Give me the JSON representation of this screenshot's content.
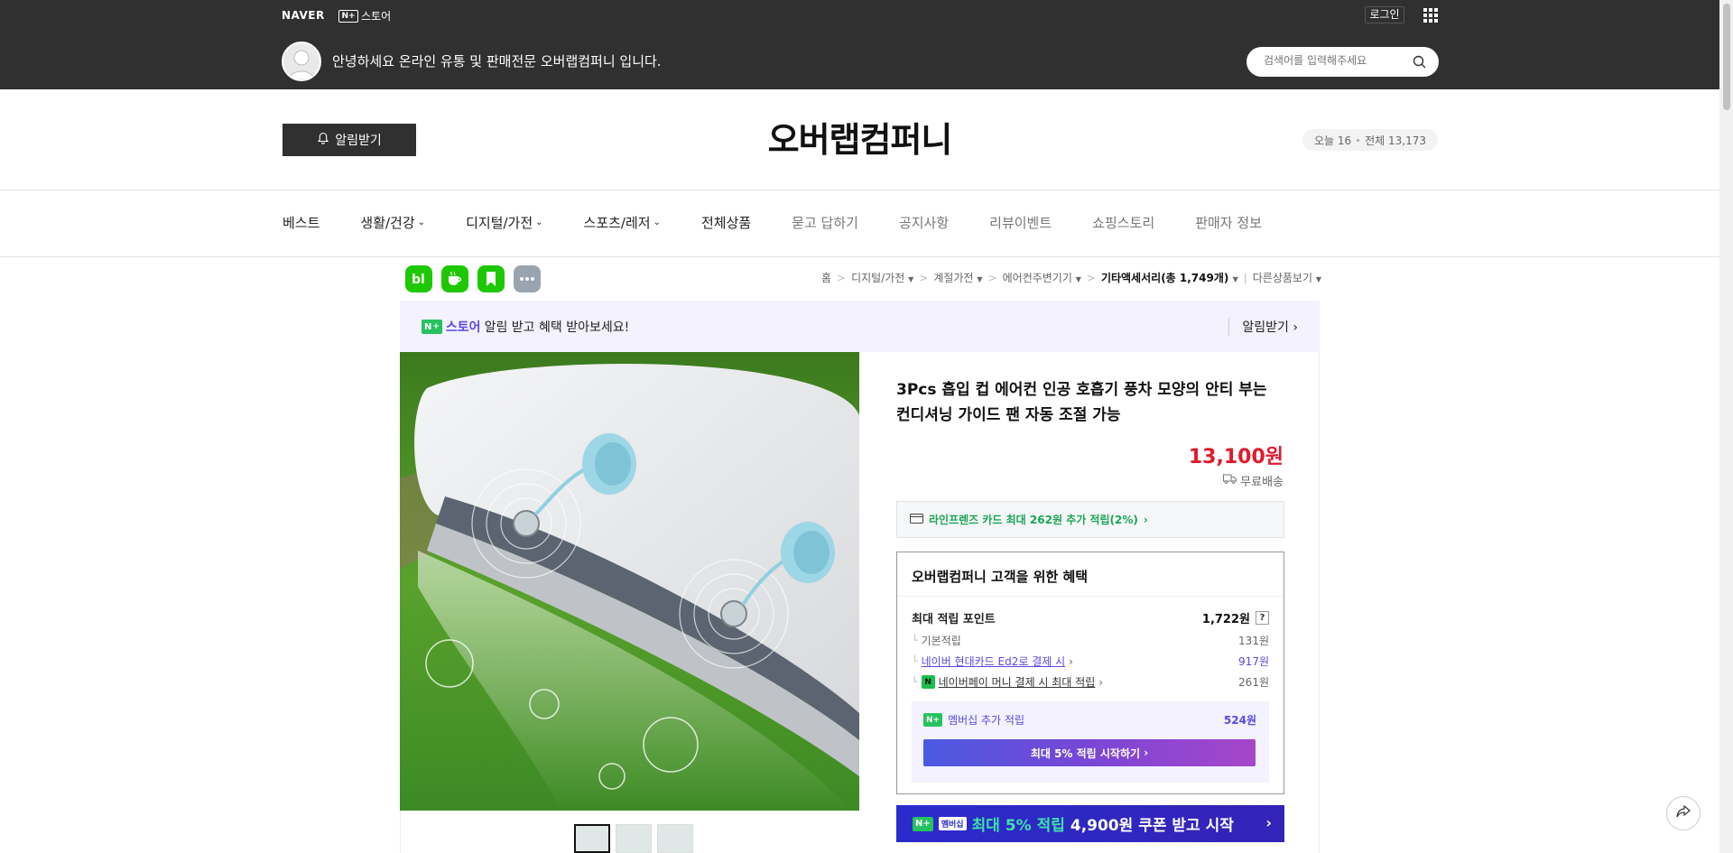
{
  "topbar": {
    "naver_logo": "NAVER",
    "nstore_label": "스토어",
    "nplus_badge": "N+",
    "login_label": "로그인",
    "greeting": "안녕하세요 온라인 유통 및 판매전문 오버랩컴퍼니 입니다.",
    "search_placeholder": "검색어를 입력해주세요"
  },
  "store": {
    "alarm_button": "알림받기",
    "name": "오버랩컴퍼니",
    "visitors_today": "오늘 16",
    "visitors_total": "전체 13,173"
  },
  "gnb": {
    "items": [
      {
        "label": "베스트",
        "has_dropdown": false
      },
      {
        "label": "생활/건강",
        "has_dropdown": true
      },
      {
        "label": "디지털/가전",
        "has_dropdown": true
      },
      {
        "label": "스포츠/레저",
        "has_dropdown": true
      },
      {
        "label": "전체상품",
        "has_dropdown": false
      },
      {
        "label": "묻고 답하기",
        "has_dropdown": false
      },
      {
        "label": "공지사항",
        "has_dropdown": false
      },
      {
        "label": "리뷰이벤트",
        "has_dropdown": false
      },
      {
        "label": "쇼핑스토리",
        "has_dropdown": false
      },
      {
        "label": "판매자 정보",
        "has_dropdown": false
      }
    ]
  },
  "channel_icons": [
    "blog-icon",
    "cafe-icon",
    "bookmark-icon",
    "more-icon"
  ],
  "breadcrumb": {
    "home": "홈",
    "c1": "디지털/가전",
    "c2": "계절가전",
    "c3": "에어컨주변기기",
    "c4": "기타액세서리",
    "c4_count": "(총 1,749개)",
    "other": "다른상품보기"
  },
  "notice": {
    "brand": "스토어",
    "text": "알림 받고 혜택 받아보세요!",
    "action": "알림받기"
  },
  "product": {
    "title": "3Pcs 흡입 컵 에어컨 인공 호흡기 풍차 모양의 안티 부는 컨디셔닝 가이드 팬 자동 조절 가능",
    "price": "13,100원",
    "shipping": "무료배송",
    "card_benefit": "라인프렌즈 카드 최대 262원 추가 적립(2%)"
  },
  "benefits": {
    "title": "오버랩컴퍼니 고객을 위한 혜택",
    "max_points_label": "최대 적립 포인트",
    "max_points_value": "1,722원",
    "basic_label": "기본적립",
    "basic_value": "131원",
    "card_label": "네이버 현대카드 Ed2로 결제 시",
    "card_value": "917원",
    "pay_label": "네이버페이 머니 결제 시 최대 적립",
    "pay_value": "261원",
    "membership_label": "멤버십 추가 적립",
    "membership_value": "524원",
    "membership_button": "최대 5% 적립 시작하기"
  },
  "coupon": {
    "badge": "멤버십",
    "highlight": "최대 5% 적립",
    "text": "4,900원 쿠폰 받고 시작"
  },
  "colors": {
    "topbar_bg": "#303030",
    "price_red": "#e01a2d",
    "naver_green": "#25c25f",
    "purple": "#5a48e6"
  }
}
